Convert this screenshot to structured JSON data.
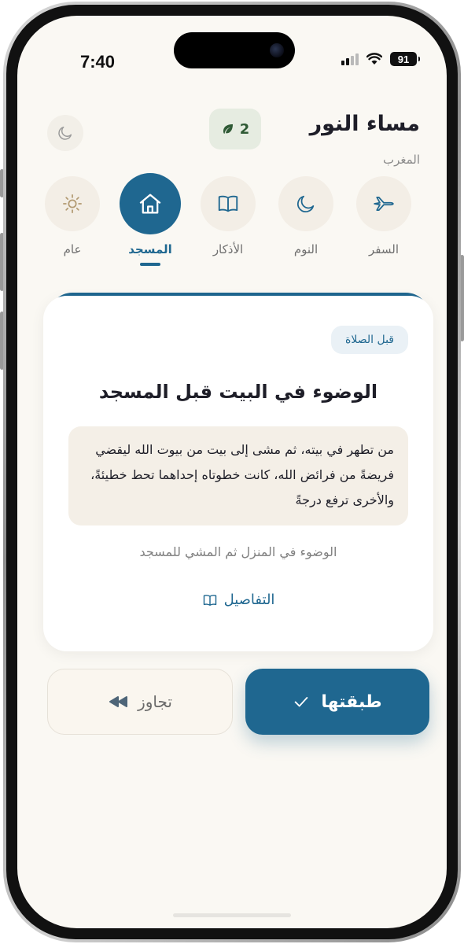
{
  "status": {
    "time": "7:40",
    "battery": "91"
  },
  "header": {
    "greeting": "مساء النور",
    "prayer": "المغرب",
    "streak_count": "2"
  },
  "categories": [
    {
      "label": "السفر",
      "icon": "airplane-icon"
    },
    {
      "label": "النوم",
      "icon": "moon-icon"
    },
    {
      "label": "الأذكار",
      "icon": "book-icon"
    },
    {
      "label": "المسجد",
      "icon": "mosque-house-icon",
      "active": true
    },
    {
      "label": "عام",
      "icon": "sun-icon"
    }
  ],
  "card": {
    "tag": "قبل الصلاة",
    "title": "الوضوء في البيت قبل المسجد",
    "hadith": "من تطهر في بيته، ثم مشى إلى بيت من بيوت الله ليقضي فريضةً من فرائض الله، كانت خطوتاه إحداهما تحط خطيئةً، والأخرى ترفع درجةً",
    "description": "الوضوء في المنزل ثم المشي للمسجد",
    "details_label": "التفاصيل"
  },
  "actions": {
    "done_label": "طبقتها",
    "skip_label": "تجاوز"
  },
  "colors": {
    "accent": "#1f6790",
    "background": "#faf8f3",
    "hadith_bg": "#f4efe7",
    "streak_bg": "#e6ece1",
    "leaf": "#2f5a35"
  }
}
